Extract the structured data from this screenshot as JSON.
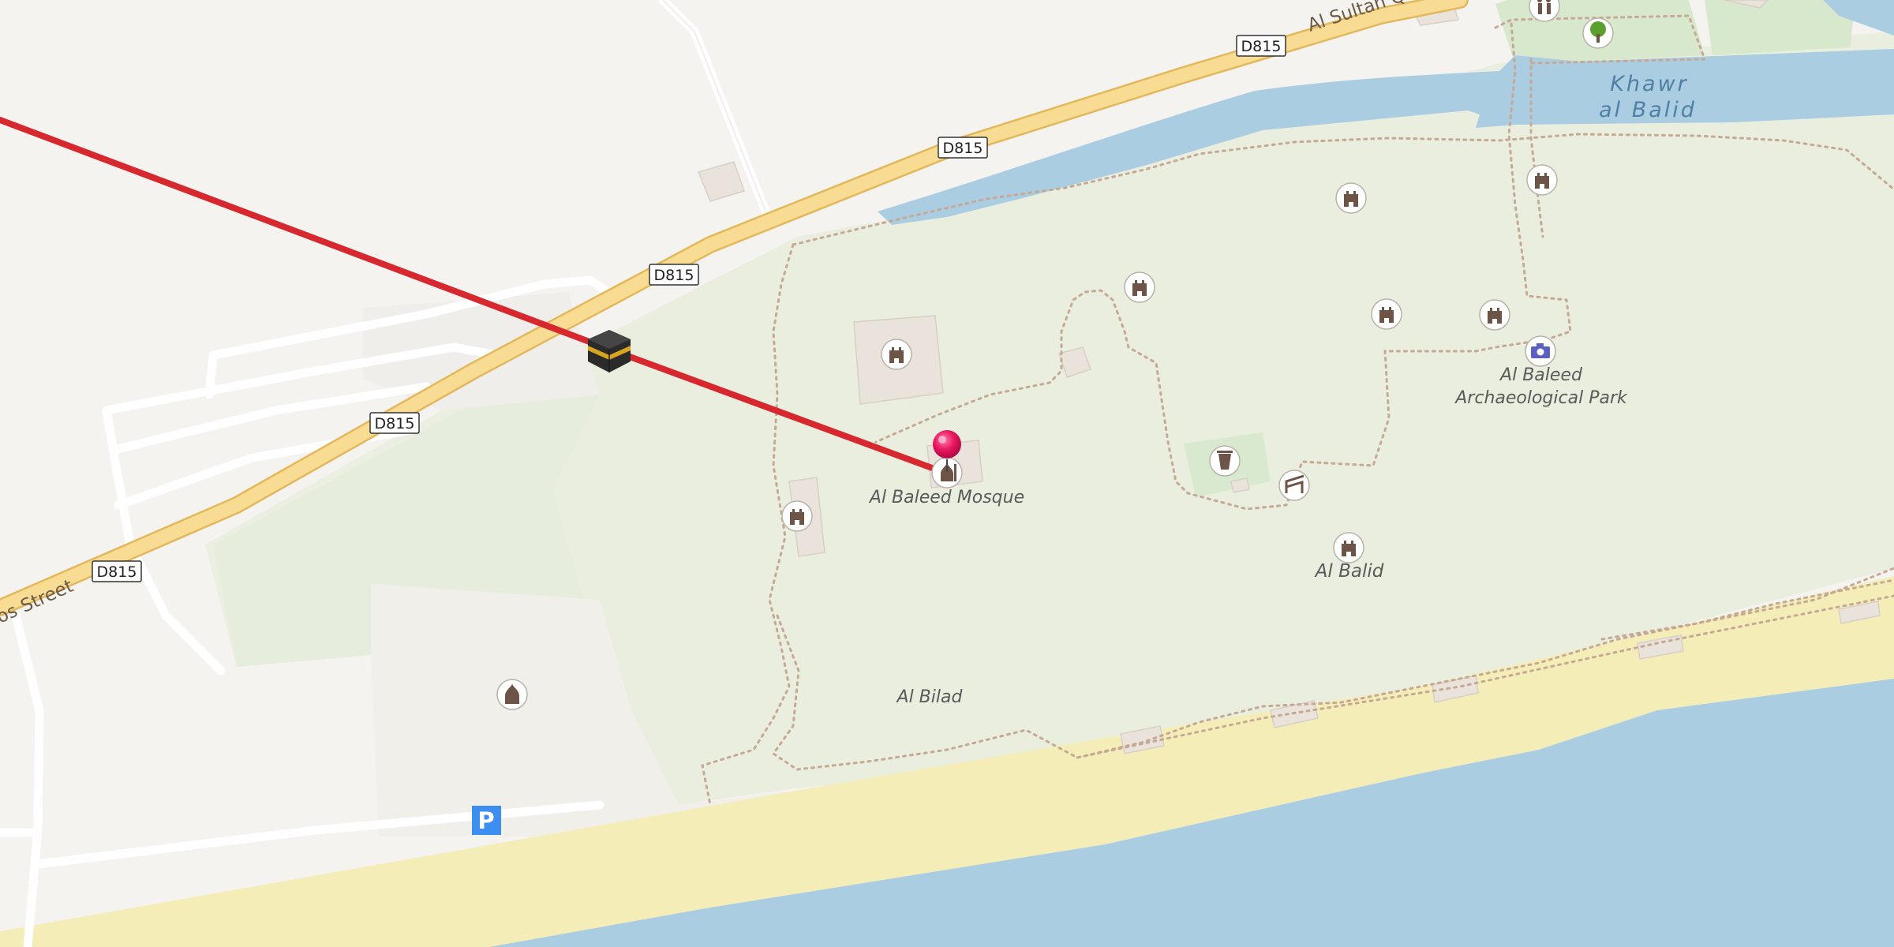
{
  "map": {
    "route_color": "#d7282f",
    "marker_color": "#e8155f",
    "sea_color": "#abcde2",
    "beach_color": "#f5edb8",
    "park_color": "#e8eedd",
    "road_shields": [
      "D815",
      "D815",
      "D815",
      "D815",
      "D815"
    ],
    "streets": {
      "qaboos": "os Street",
      "al_sultan": "Al Sultan Qa"
    },
    "places": {
      "mosque": "Al Baleed Mosque",
      "park_line1": "Al Baleed",
      "park_line2": "Archaeological Park",
      "al_balid": "Al Balid",
      "al_bilad": "Al Bilad"
    },
    "water": {
      "khawr_line1": "Khawr",
      "khawr_line2": "al Balid"
    },
    "icons": [
      "kaaba-icon",
      "castle-icon",
      "mosque-icon",
      "map-marker-icon",
      "camera-icon",
      "tree-icon",
      "toilets-icon",
      "waste-basket-icon",
      "bench-icon",
      "parking-icon"
    ],
    "parking_label": "P"
  }
}
